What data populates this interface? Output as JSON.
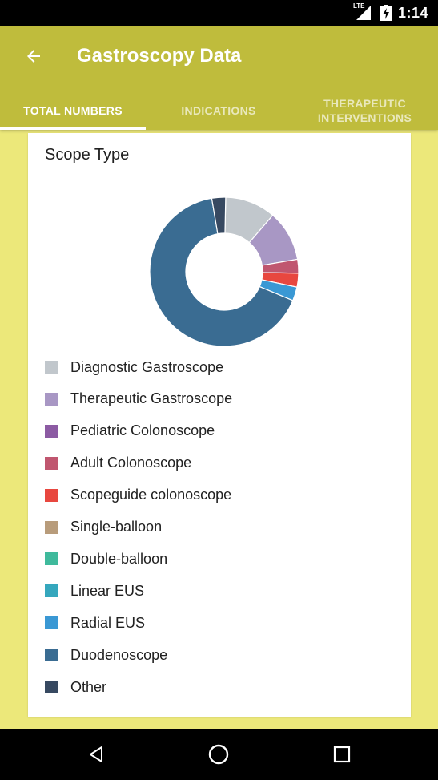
{
  "status_bar": {
    "time": "1:14",
    "network": "LTE",
    "icons": [
      "signal-icon",
      "battery-charging-icon"
    ]
  },
  "app_bar": {
    "title": "Gastroscopy Data",
    "back_icon": "arrow-back-icon",
    "color": "#bfbc3c"
  },
  "tabs": [
    {
      "label": "TOTAL NUMBERS",
      "selected": true
    },
    {
      "label": "INDICATIONS",
      "selected": false
    },
    {
      "label": "THERAPEUTIC INTERVENTIONS",
      "selected": false
    }
  ],
  "card": {
    "title": "Scope Type"
  },
  "chart_data": {
    "type": "pie",
    "donut": true,
    "series": [
      {
        "name": "Diagnostic Gastroscope",
        "value": 11,
        "color": "#c1c7cc"
      },
      {
        "name": "Therapeutic Gastroscope",
        "value": 11,
        "color": "#a897c4"
      },
      {
        "name": "Pediatric Colonoscope",
        "value": 0,
        "color": "#8c5ba3"
      },
      {
        "name": "Adult Colonoscope",
        "value": 3,
        "color": "#c0566f"
      },
      {
        "name": "Scopeguide colonoscope",
        "value": 3,
        "color": "#e8473f"
      },
      {
        "name": "Single-balloon",
        "value": 0,
        "color": "#b89c7b"
      },
      {
        "name": "Double-balloon",
        "value": 0,
        "color": "#3fba9c"
      },
      {
        "name": "Linear EUS",
        "value": 0,
        "color": "#35a7bd"
      },
      {
        "name": "Radial EUS",
        "value": 3,
        "color": "#3a98d4"
      },
      {
        "name": "Duodenoscope",
        "value": 66,
        "color": "#3a6c92"
      },
      {
        "name": "Other",
        "value": 3,
        "color": "#374961"
      }
    ]
  },
  "nav_bar": {
    "icons": [
      "back-triangle-icon",
      "home-circle-icon",
      "recents-square-icon"
    ]
  }
}
